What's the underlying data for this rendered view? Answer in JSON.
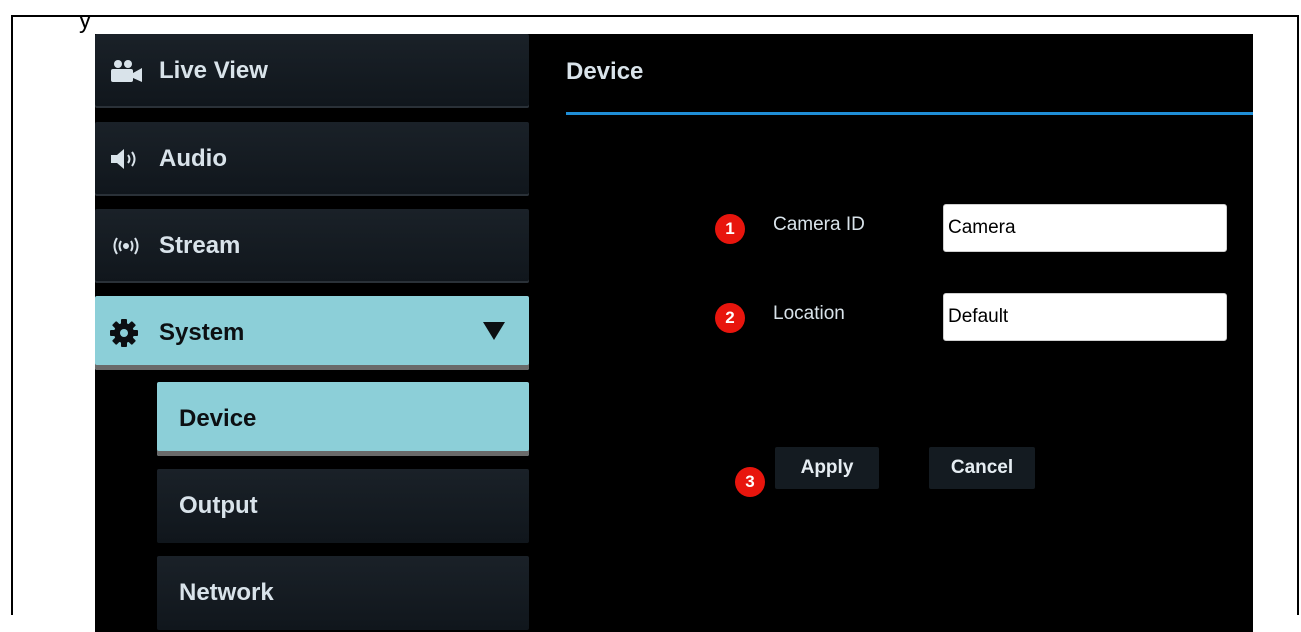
{
  "corner_glyph": "y",
  "sidebar": {
    "items": [
      {
        "label": "Live View",
        "icon": "camera-icon"
      },
      {
        "label": "Audio",
        "icon": "speaker-icon"
      },
      {
        "label": "Stream",
        "icon": "broadcast-icon"
      },
      {
        "label": "System",
        "icon": "gear-icon",
        "expanded": true
      }
    ],
    "sub_items": [
      {
        "label": "Device",
        "active": true
      },
      {
        "label": "Output"
      },
      {
        "label": "Network"
      }
    ]
  },
  "panel": {
    "title": "Device",
    "fields": [
      {
        "badge": "1",
        "label": "Camera ID",
        "value": "Camera"
      },
      {
        "badge": "2",
        "label": "Location",
        "value": "Default"
      }
    ],
    "apply_badge": "3",
    "apply_label": "Apply",
    "cancel_label": "Cancel"
  },
  "colors": {
    "accent": "#8ccfd8",
    "rule": "#1f8ed6",
    "badge": "#e8150d",
    "background": "#000000"
  }
}
